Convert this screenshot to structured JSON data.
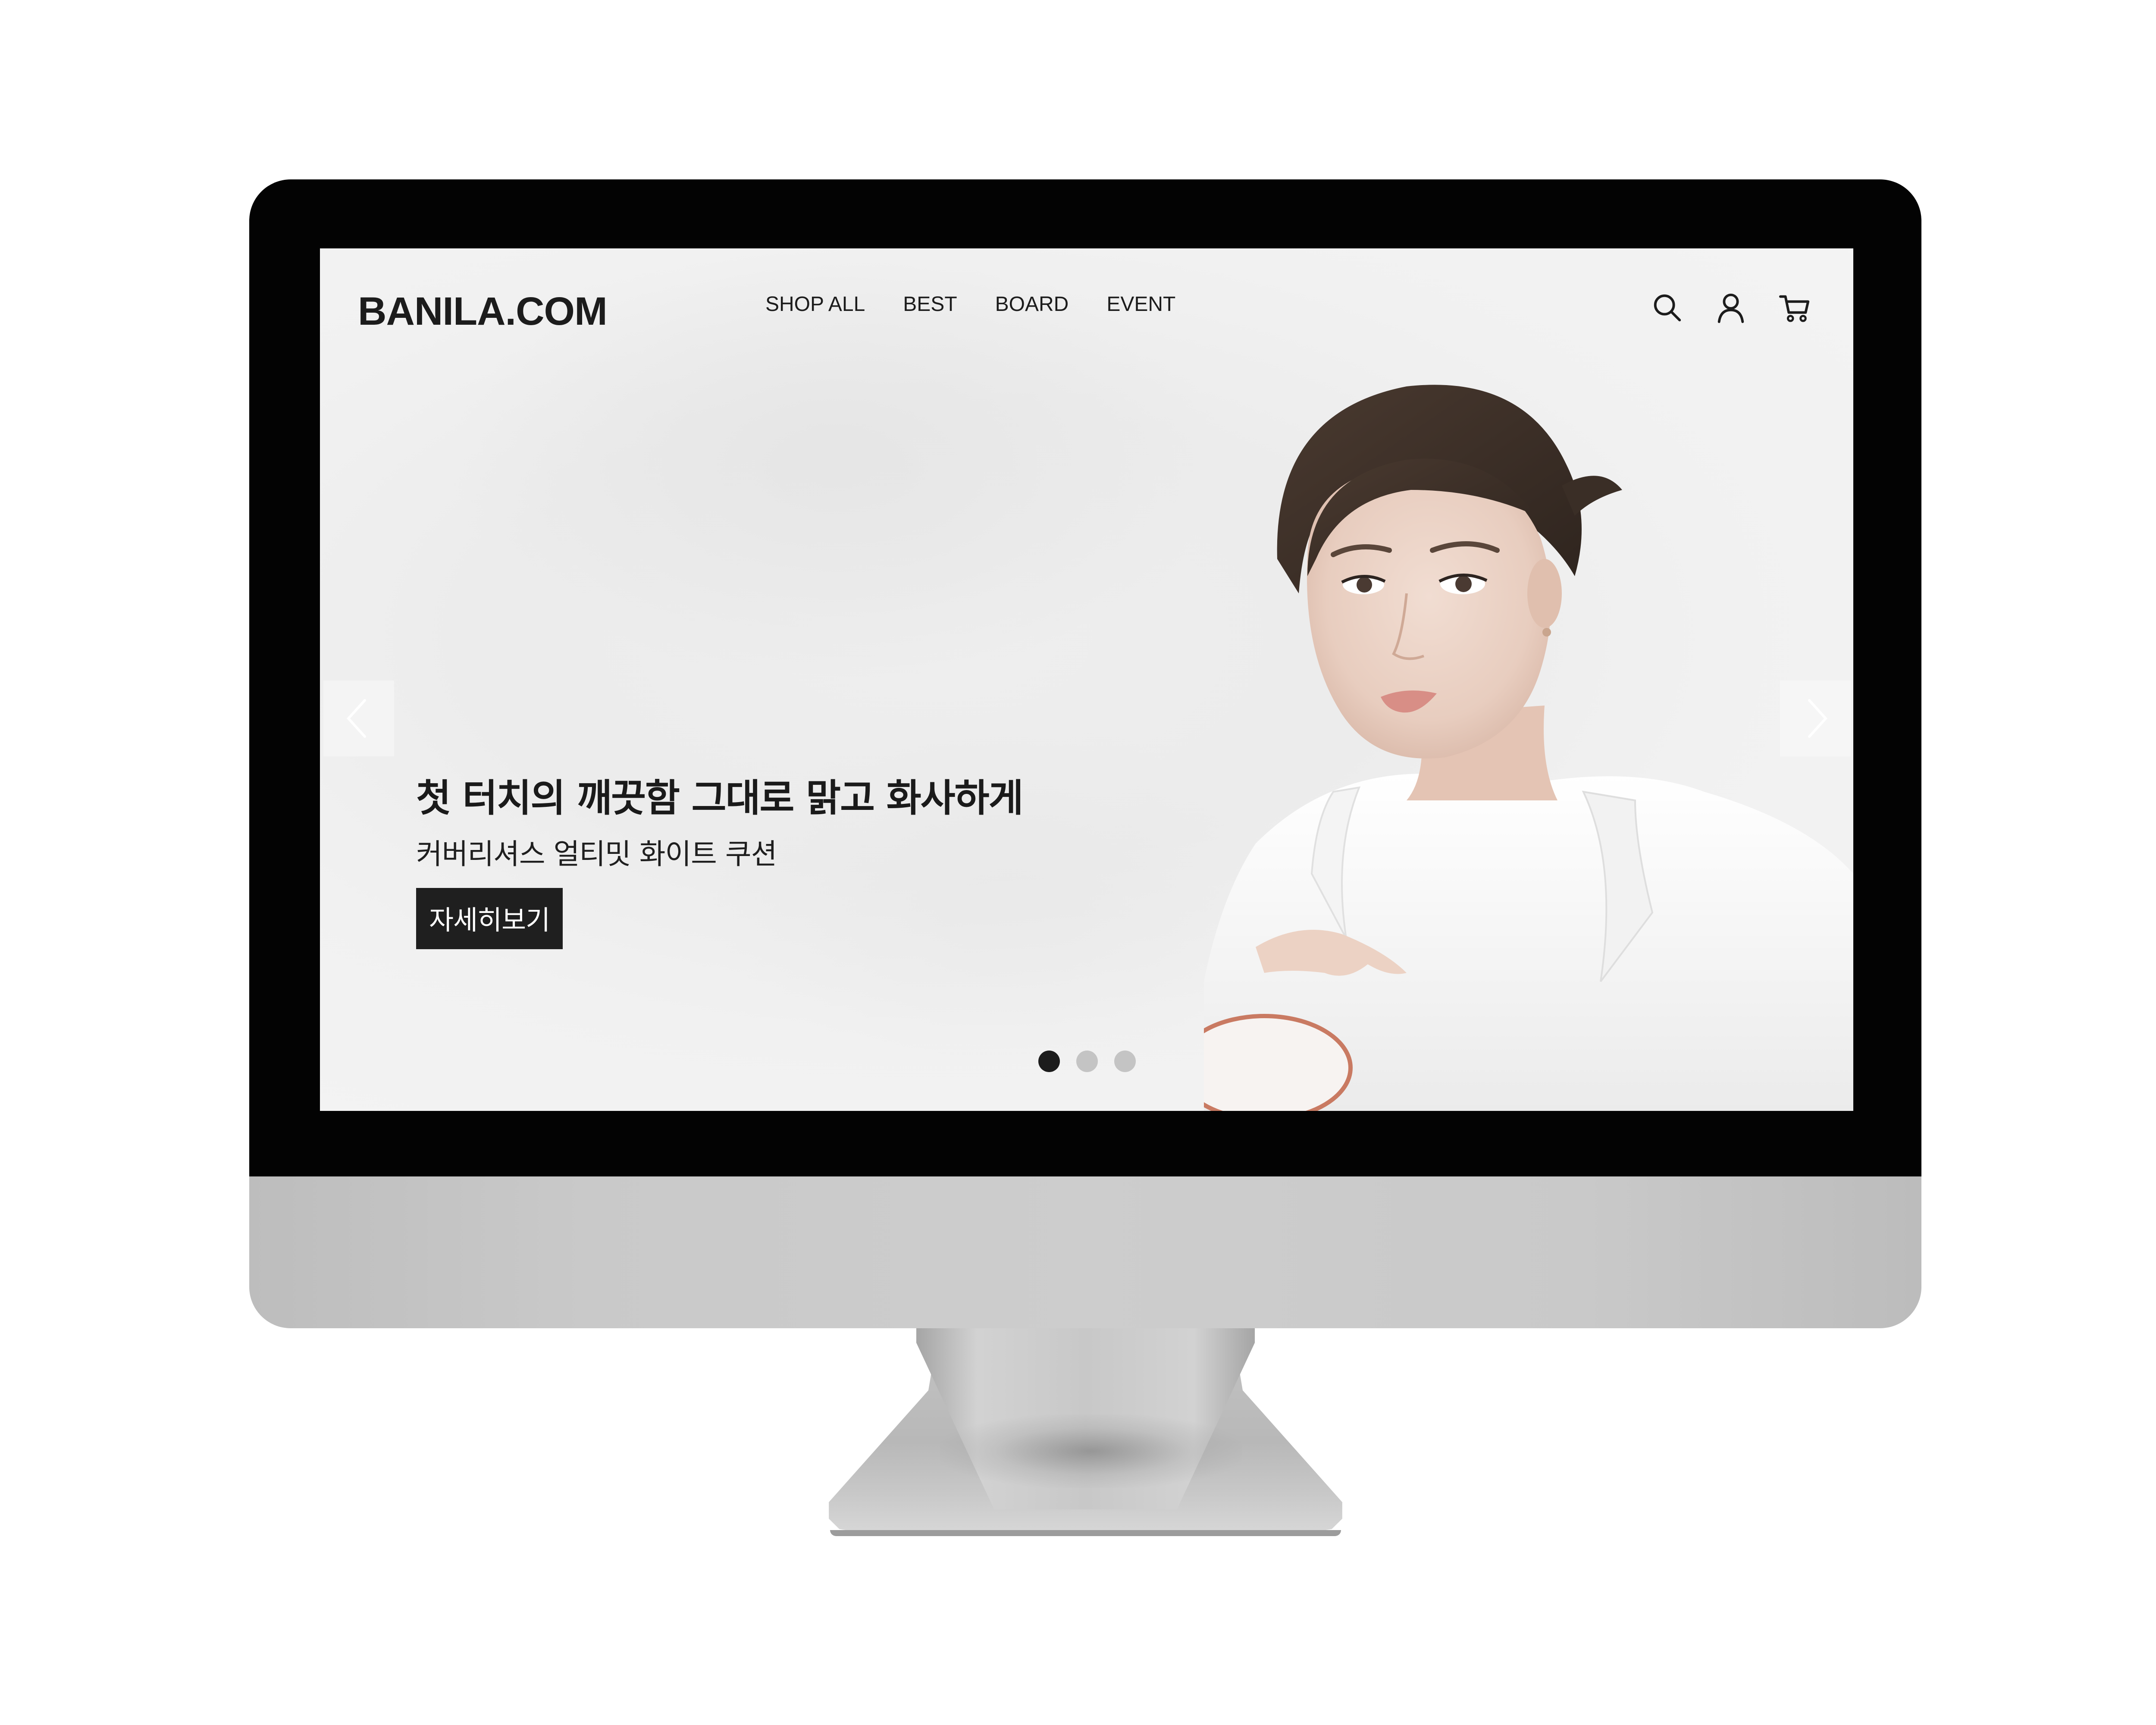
{
  "header": {
    "logo": "BANILA.COM",
    "nav": [
      "SHOP ALL",
      "BEST",
      "BOARD",
      "EVENT"
    ],
    "icons": [
      "search-icon",
      "user-icon",
      "cart-icon"
    ]
  },
  "hero": {
    "headline": "첫 터치의 깨끗함 그대로 맑고 화사하게",
    "subtitle": "커버리셔스 얼티밋 화이트 쿠션",
    "button_label": "자세히보기"
  },
  "slider": {
    "total_slides": 3,
    "active_slide": 1,
    "arrows": [
      "chevron-left-icon",
      "chevron-right-icon"
    ]
  },
  "colors": {
    "text": "#1c1c1c",
    "button_bg": "#1f1f1f",
    "dot_active": "#1c1c1c",
    "dot_inactive": "#c4c4c4",
    "bezel": "#030303",
    "aluminum": "#c9c9c9"
  }
}
